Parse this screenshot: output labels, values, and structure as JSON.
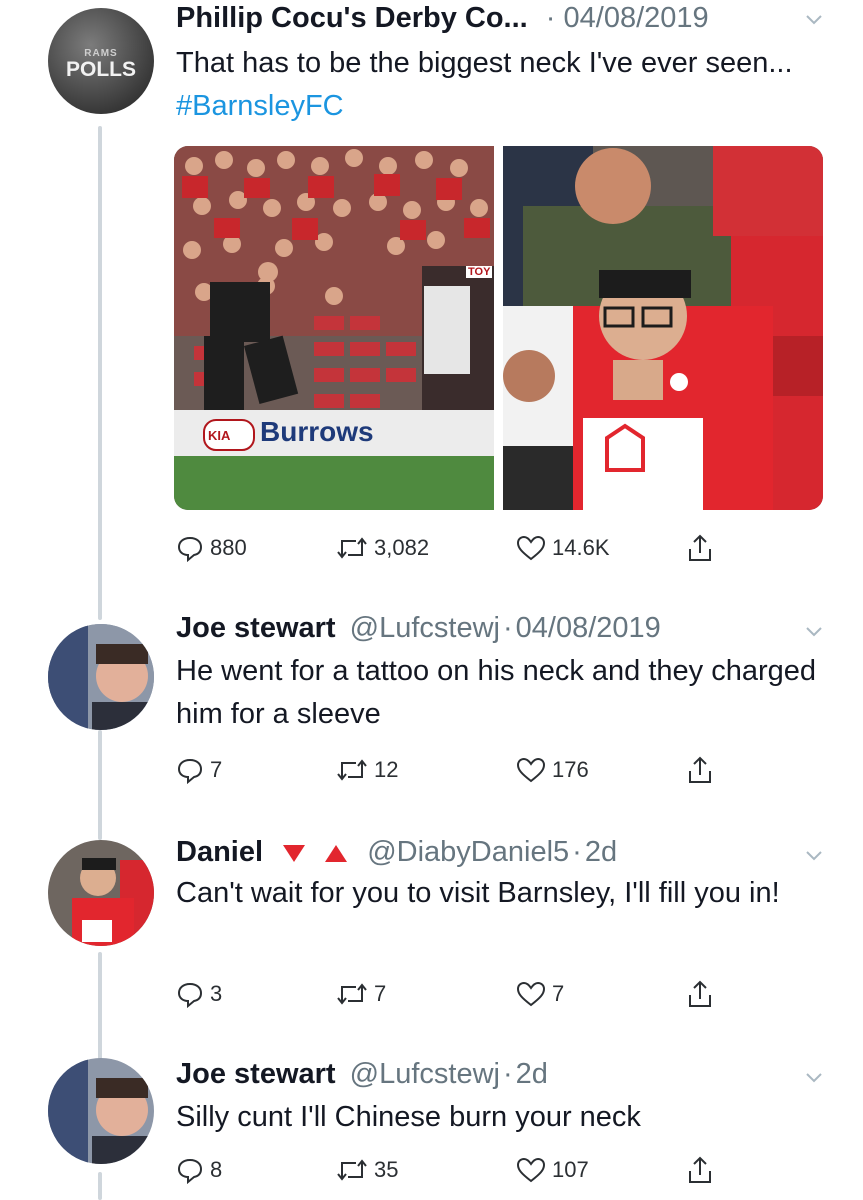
{
  "tweets": [
    {
      "name": "Phillip Cocu's Derby Co...",
      "handle": "",
      "time": "04/08/2019",
      "text_before": "That has to be the biggest neck I've ever seen... ",
      "hashtag": "#BarnsleyFC",
      "avatar_text_small": "RAMS",
      "avatar_text_big": "POLLS",
      "stats": {
        "replies": "880",
        "retweets": "3,082",
        "likes": "14.6K"
      },
      "photo_left_caption": "Burrows",
      "photo_left_kia": "KIA",
      "photo_left_toy": "TOY"
    },
    {
      "name": "Joe stewart",
      "handle": "@Lufcstewj",
      "time": "04/08/2019",
      "text": "He went for a tattoo on his neck and they charged him for a sleeve",
      "stats": {
        "replies": "7",
        "retweets": "12",
        "likes": "176"
      }
    },
    {
      "name": "Daniel",
      "handle": "@DiabyDaniel5",
      "time": "2d",
      "text": "Can't wait for you to visit Barnsley, I'll fill you in!",
      "stats": {
        "replies": "3",
        "retweets": "7",
        "likes": "7"
      }
    },
    {
      "name": "Joe stewart",
      "handle": "@Lufcstewj",
      "time": "2d",
      "text": "Silly cunt I'll Chinese burn your neck",
      "stats": {
        "replies": "8",
        "retweets": "35",
        "likes": "107"
      }
    }
  ],
  "separator": "·",
  "colors": {
    "link": "#1b95e0",
    "meta": "#66757f",
    "thread": "#cfd6dc",
    "barnsley_red": "#e2262e"
  },
  "icons": [
    "reply-icon",
    "retweet-icon",
    "like-icon",
    "share-icon",
    "chevron-down-icon"
  ]
}
